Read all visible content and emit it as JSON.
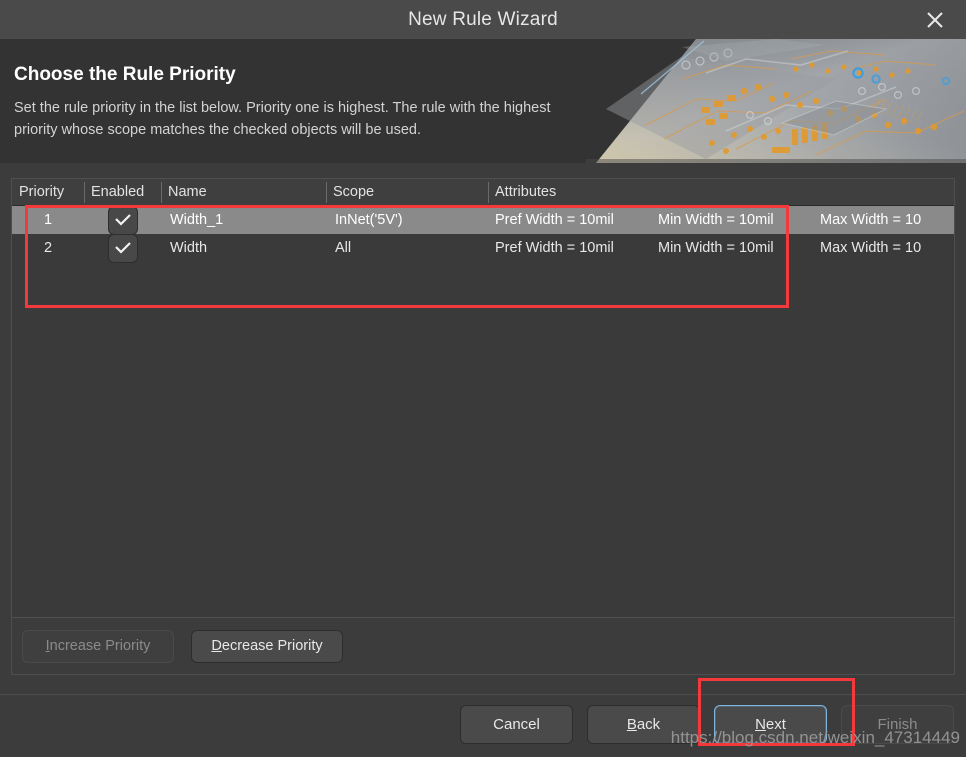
{
  "window": {
    "title": "New Rule Wizard",
    "close_icon": "close-icon"
  },
  "header": {
    "title": "Choose the Rule Priority",
    "description": "Set the rule priority in the list below. Priority one is highest. The rule with the highest priority whose scope matches the checked objects will be used."
  },
  "table": {
    "columns": [
      "Priority",
      "Enabled",
      "Name",
      "Scope",
      "Attributes"
    ],
    "rows": [
      {
        "priority": "1",
        "enabled": true,
        "name": "Width_1",
        "scope": "InNet('5V')",
        "attributes": [
          "Pref Width = 10mil",
          "Min Width = 10mil",
          "Max Width = 10"
        ],
        "selected": true
      },
      {
        "priority": "2",
        "enabled": true,
        "name": "Width",
        "scope": "All",
        "attributes": [
          "Pref Width = 10mil",
          "Min Width = 10mil",
          "Max Width = 10"
        ],
        "selected": false
      }
    ]
  },
  "priority_bar": {
    "increase_label": "Increase Priority",
    "increase_accel": "I",
    "increase_rest": "ncrease Priority",
    "increase_enabled": false,
    "decrease_label": "Decrease Priority",
    "decrease_accel": "D",
    "decrease_rest": "ecrease Priority",
    "decrease_enabled": true
  },
  "footer": {
    "cancel_label": "Cancel",
    "back_accel": "B",
    "back_rest": "ack",
    "next_accel": "N",
    "next_rest": "ext",
    "finish_label": "Finish",
    "finish_enabled": false
  },
  "watermark": {
    "text": "https://blog.csdn.net/weixin_47314449"
  },
  "colors": {
    "accent_red": "#f4393c",
    "focus_blue": "#7db5e0",
    "dialog_bg": "#3c3c3c",
    "titlebar_bg": "#4a4a4a",
    "selected_row": "#8a8a8a"
  }
}
